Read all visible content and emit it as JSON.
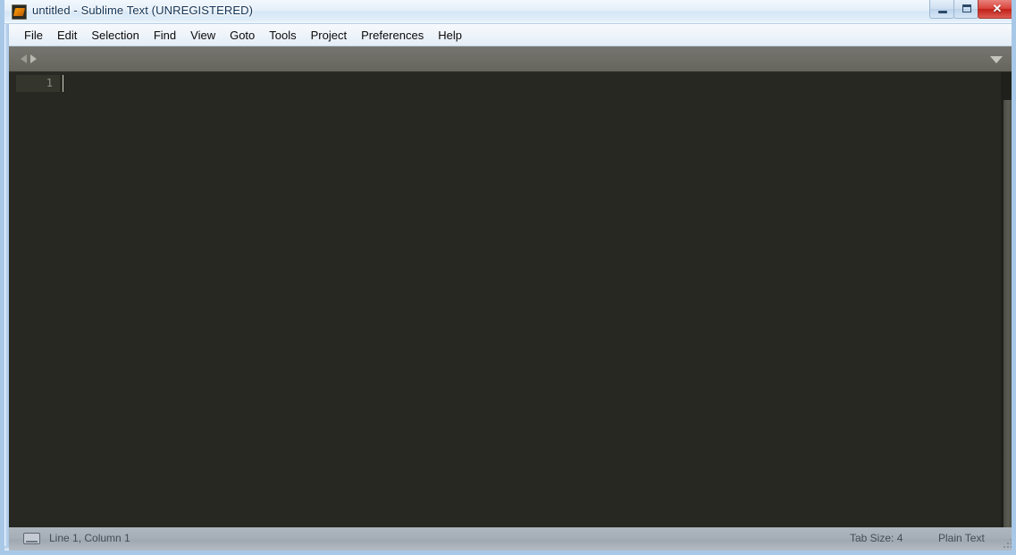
{
  "window": {
    "title": "untitled - Sublime Text (UNREGISTERED)",
    "app_icon": "sublime-text-icon",
    "controls": {
      "minimize_label": "Minimize",
      "maximize_label": "Maximize",
      "close_label": "✕"
    },
    "border_color": "#a8c8e8",
    "titlebar_text_color": "#123355"
  },
  "menubar": {
    "items": [
      {
        "label": "File"
      },
      {
        "label": "Edit"
      },
      {
        "label": "Selection"
      },
      {
        "label": "Find"
      },
      {
        "label": "View"
      },
      {
        "label": "Goto"
      },
      {
        "label": "Tools"
      },
      {
        "label": "Project"
      },
      {
        "label": "Preferences"
      },
      {
        "label": "Help"
      }
    ]
  },
  "tabbar": {
    "prev_icon": "arrow-left-icon",
    "next_icon": "arrow-right-icon",
    "menu_icon": "chevron-down-icon",
    "background_color": "#6e6e67",
    "tabs": []
  },
  "editor": {
    "background_color": "#272822",
    "line_numbers": [
      "1"
    ],
    "content": "",
    "caret_line": 1,
    "caret_column": 1,
    "gutter_highlight_color": "#34352d"
  },
  "statusbar": {
    "console_icon": "console-icon",
    "position_text": "Line 1, Column 1",
    "tab_size_text": "Tab Size: 4",
    "syntax_text": "Plain Text",
    "background_color": "#a6aeb7",
    "text_color": "#454d56"
  }
}
